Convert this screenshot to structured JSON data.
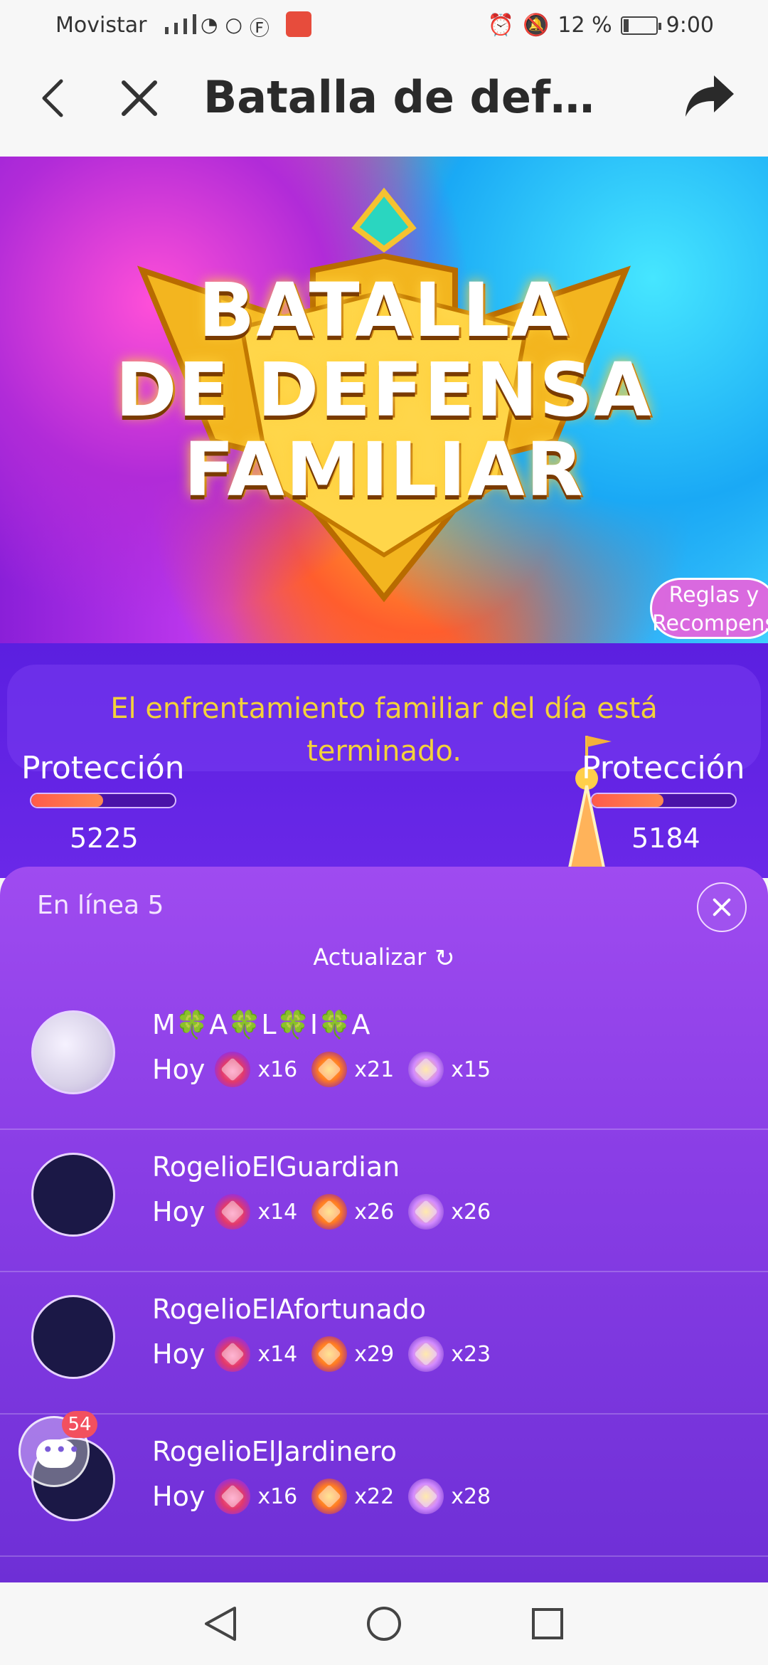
{
  "status_bar": {
    "carrier": "Movistar",
    "battery_percent": "12 %",
    "time": "9:00",
    "icons": [
      "signal-icon",
      "wifi-icon",
      "whatsapp-icon",
      "facebook-icon",
      "huawei-icon",
      "alarm-icon",
      "mute-icon",
      "battery-icon"
    ]
  },
  "app_bar": {
    "title": "Batalla de defen..."
  },
  "banner": {
    "title_line1": "BATALLA",
    "title_line2": "DE DEFENSA",
    "title_line3": "FAMILIAR",
    "rules_line1": "Reglas y",
    "rules_line2": "Recompensa"
  },
  "battle": {
    "ended_line1": "El enfrentamiento familiar del día está",
    "ended_line2": "terminado.",
    "left": {
      "label": "Protección",
      "value": "5225",
      "progress": 0.5
    },
    "right": {
      "label": "Protección",
      "value": "5184",
      "progress": 0.5
    }
  },
  "sheet": {
    "online_label": "En línea",
    "online_count": "5",
    "refresh_label": "Actualizar",
    "members": [
      {
        "name": "M🍀A🍀L🍀I🍀A",
        "day": "Hoy",
        "g1": "x16",
        "g2": "x21",
        "g3": "x15"
      },
      {
        "name": "RogelioElGuardian",
        "day": "Hoy",
        "g1": "x14",
        "g2": "x26",
        "g3": "x26"
      },
      {
        "name": "RogelioElAfortunado",
        "day": "Hoy",
        "g1": "x14",
        "g2": "x29",
        "g3": "x23"
      },
      {
        "name": "RogelioElJardinero",
        "day": "Hoy",
        "g1": "x16",
        "g2": "x22",
        "g3": "x28"
      }
    ]
  },
  "chat_badge": "54",
  "colors": {
    "sheet_top": "#9f4bf0",
    "sheet_bottom": "#6e2fd6",
    "ended_text": "#f3d23a",
    "progress_fill": "#ff5a4a"
  }
}
